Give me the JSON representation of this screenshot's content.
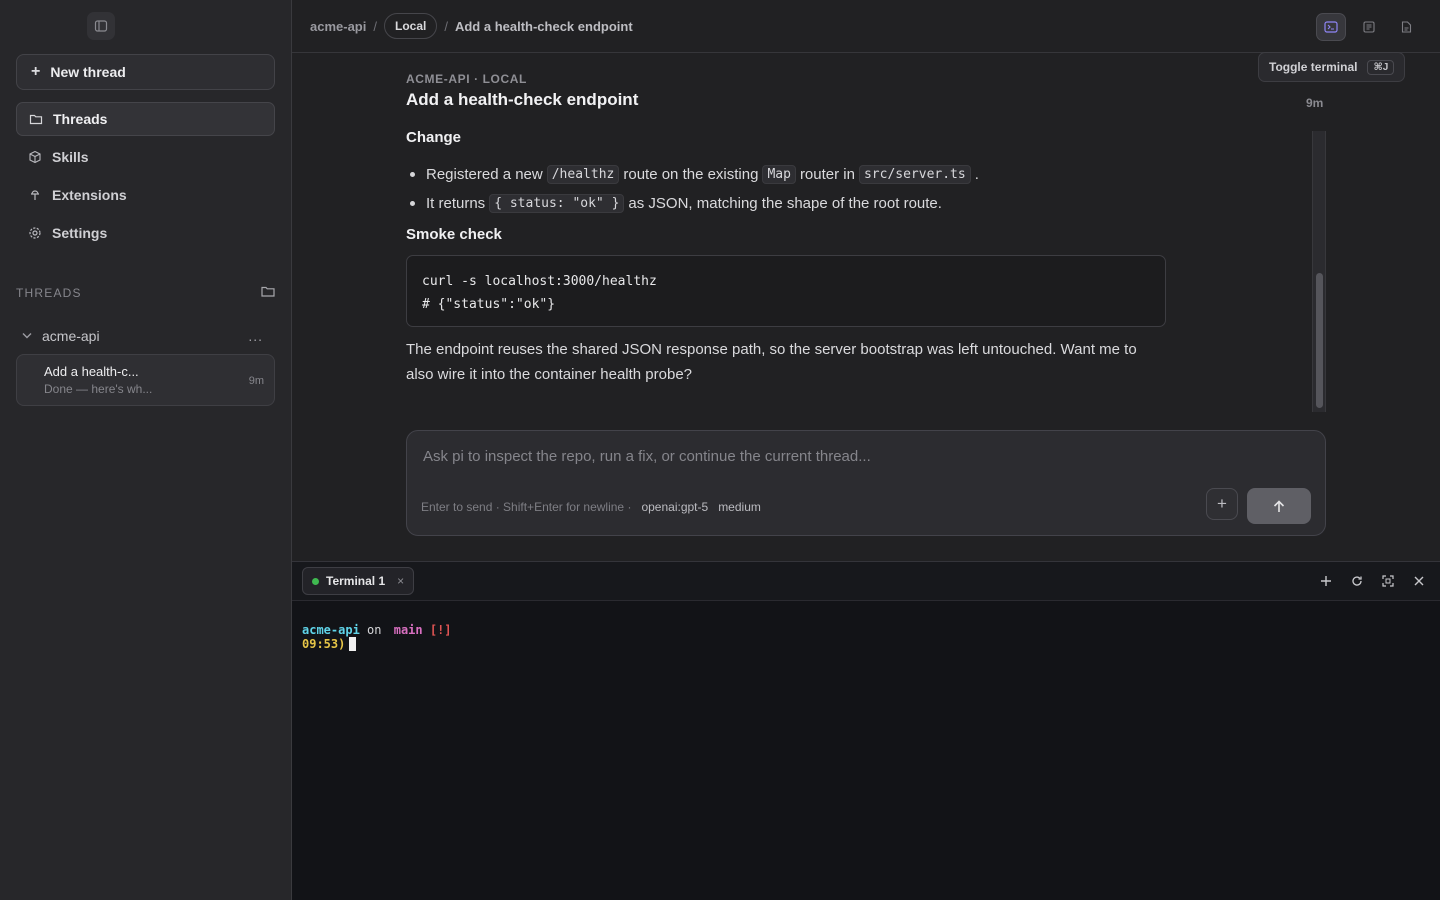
{
  "sidebar": {
    "new_thread_label": "New thread",
    "nav": [
      {
        "label": "Threads",
        "icon": "folder-icon",
        "active": true
      },
      {
        "label": "Skills",
        "icon": "cube-icon",
        "active": false
      },
      {
        "label": "Extensions",
        "icon": "plug-icon",
        "active": false
      },
      {
        "label": "Settings",
        "icon": "gear-icon",
        "active": false
      }
    ],
    "threads_heading": "THREADS",
    "group": {
      "name": "acme-api",
      "more": "..."
    },
    "thread": {
      "title": "Add a health-c...",
      "preview": "Done — here's wh...",
      "age": "9m"
    }
  },
  "header": {
    "crumb_repo": "acme-api",
    "crumb_sep": "/",
    "crumb_env": "Local",
    "crumb_title": "Add a health-check endpoint"
  },
  "tooltip": {
    "label": "Toggle terminal",
    "shortcut": "⌘J"
  },
  "message": {
    "eyebrow": "ACME-API · LOCAL",
    "title": "Add a health-check endpoint",
    "age": "9m",
    "section1_heading": "Change",
    "bullet1": {
      "a": "Registered a new",
      "code1": "/healthz",
      "b": "route on the existing",
      "code2": "Map",
      "c": "router in",
      "code3": "src/server.ts",
      "d": "."
    },
    "bullet2": {
      "a": "It returns",
      "code1": "{ status: \"ok\" }",
      "b": "as JSON, matching the shape of the root route."
    },
    "section2_heading": "Smoke check",
    "code_lines": [
      "curl -s localhost:3000/healthz",
      "# {\"status\":\"ok\"}"
    ],
    "paragraph": "The endpoint reuses the shared JSON response path, so the server bootstrap was left untouched. Want me to also wire it into the container health probe?"
  },
  "composer": {
    "placeholder": "Ask pi to inspect the repo, run a fix, or continue the current thread...",
    "hint": "Enter to send · Shift+Enter for newline ·",
    "model": "openai:gpt-5",
    "effort": "medium"
  },
  "terminal": {
    "tab_label": "Terminal 1",
    "tab_close": "×",
    "status_color": "#3fb950",
    "prompt_repo": "acme-api",
    "prompt_on": "on",
    "prompt_branch": "main",
    "prompt_flag": "[!]",
    "prompt_time": "09:53)"
  },
  "colors": {
    "accent": "#7c6cf0",
    "background": "#212123"
  }
}
